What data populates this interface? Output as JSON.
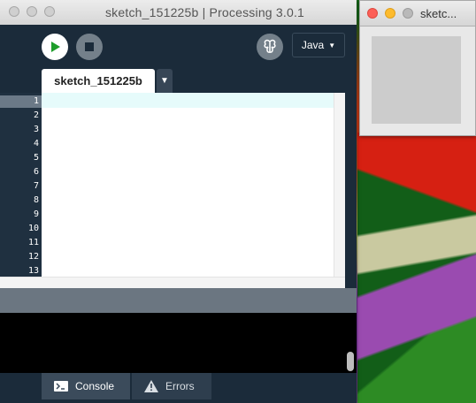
{
  "main_window": {
    "title": "sketch_151225b | Processing 3.0.1",
    "toolbar": {
      "run_icon": "play-icon",
      "stop_icon": "stop-icon",
      "debug_icon": "butterfly-icon",
      "mode_label": "Java",
      "mode_arrow": "▼"
    },
    "tabs": {
      "active_tab": "sketch_151225b",
      "menu_arrow": "▼"
    },
    "editor": {
      "line_numbers": [
        "1",
        "2",
        "3",
        "4",
        "5",
        "6",
        "7",
        "8",
        "9",
        "10",
        "11",
        "12",
        "13"
      ],
      "current_line": "1"
    },
    "footer": {
      "console_label": "Console",
      "errors_label": "Errors"
    }
  },
  "sketch_window": {
    "title": "sketc..."
  },
  "colors": {
    "ide_bg": "#1b2b3a",
    "run_green": "#1e9d2a",
    "current_line": "#e6fbfb",
    "canvas_gray": "#cccccc",
    "close_red": "#fc5f57",
    "minimize_yellow": "#fdbb2d",
    "zoom_gray": "#b9b9b9"
  }
}
